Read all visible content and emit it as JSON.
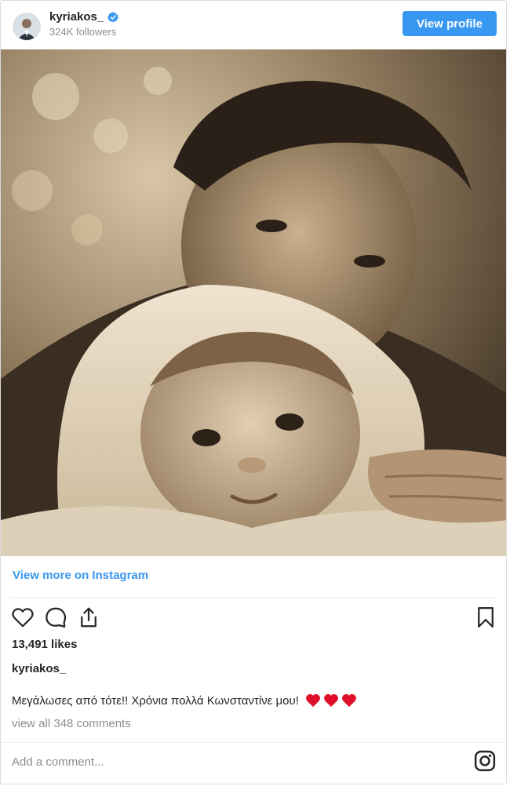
{
  "header": {
    "username": "kyriakos_",
    "followers": "324K followers",
    "view_profile_label": "View profile",
    "verified_icon": "verified-badge-icon"
  },
  "post": {
    "image_icon": "sepia-photo",
    "view_more_label": "View more on Instagram",
    "likes": "13,491 likes",
    "caption_username": "kyriakos_",
    "caption_text": "Μεγάλωσες από τότε!! Χρόνια πολλά Κωνσταντίνε μου!",
    "caption_hearts": [
      "red-heart-icon",
      "red-heart-icon",
      "red-heart-icon"
    ],
    "comments_link": "view all 348 comments",
    "add_comment_placeholder": "Add a comment..."
  },
  "colors": {
    "accent": "#3897f0",
    "muted": "#8e8e8e",
    "text": "#262626",
    "heart": "#e0102c"
  }
}
